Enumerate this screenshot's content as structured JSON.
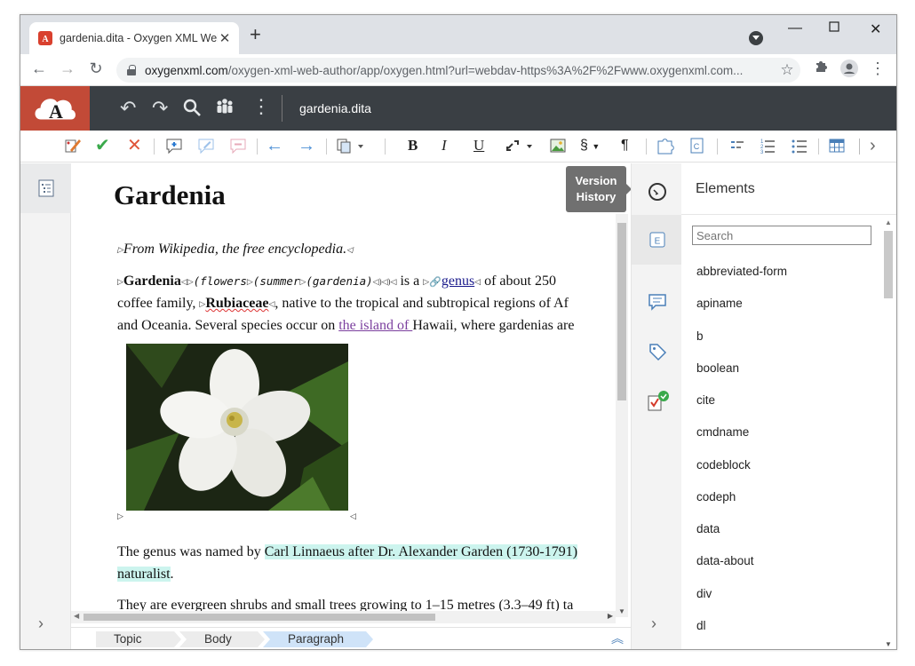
{
  "browser": {
    "tab_title": "gardenia.dita - Oxygen XML Web Author",
    "url_host": "oxygenxml.com",
    "url_path": "/oxygen-xml-web-author/app/oxygen.html?url=webdav-https%3A%2F%2Fwww.oxygenxml.com..."
  },
  "app": {
    "file_name": "gardenia.dita",
    "accent": "#c24a37",
    "header_bg": "#3a3f44"
  },
  "document": {
    "title": "Gardenia",
    "p1": "From Wikipedia, the free encyclopedia.",
    "p2": {
      "term": "Gardenia",
      "code": "(flowers",
      "code2": "(summer",
      "code3": "(gardenia)",
      "text1": " is a ",
      "link": "genus",
      "text2": " of about 250",
      "line2a": "coffee family, ",
      "rubiaceae": "Rubiaceae",
      "line2b": ", native to the tropical and subtropical regions of Af",
      "line3a": "and Oceania. Several species occur on ",
      "island_link": "the island of ",
      "line3b": "Hawaii, where gardenias are"
    },
    "p3": {
      "text1": "The genus was named by ",
      "hl1": "Carl Linnaeus after Dr. Alexander Garden (1730-1791)",
      "hl2": "naturalist",
      "text2": "."
    },
    "p4": "They are evergreen shrubs and small trees growing to 1–15 metres (3.3–49 ft) ta"
  },
  "tooltip": {
    "line1": "Version",
    "line2": "History"
  },
  "breadcrumb": [
    "Topic",
    "Body",
    "Paragraph"
  ],
  "elements_panel": {
    "title": "Elements",
    "search_placeholder": "Search",
    "items": [
      "abbreviated-form",
      "apiname",
      "b",
      "boolean",
      "cite",
      "cmdname",
      "codeblock",
      "codeph",
      "data",
      "data-about",
      "div",
      "dl"
    ]
  }
}
